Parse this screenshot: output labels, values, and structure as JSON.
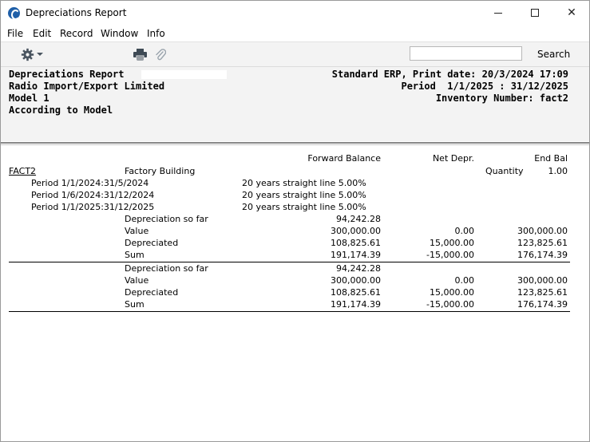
{
  "window": {
    "title": "Depreciations Report",
    "controls": {
      "minimize": "—",
      "maximize": "☐",
      "close": "✕"
    }
  },
  "menu": [
    "File",
    "Edit",
    "Record",
    "Window",
    "Info"
  ],
  "toolbar": {
    "icons": [
      "gear-icon",
      "print-icon",
      "paperclip-icon"
    ],
    "search_value": "",
    "search_label": "Search"
  },
  "header": {
    "left": [
      "Depreciations Report",
      "Radio Import/Export Limited",
      "Model 1",
      "According to Model"
    ],
    "right": [
      "Standard ERP, Print date: 20/3/2024 17:09",
      "Period  1/1/2025 : 31/12/2025",
      "Inventory Number: fact2"
    ]
  },
  "report": {
    "columns": {
      "forward_balance": "Forward Balance",
      "net_depr": "Net Depr.",
      "end_bal": "End Bal"
    },
    "asset": {
      "code": "FACT2",
      "name": "Factory Building",
      "quantity_label": "Quantity",
      "quantity": "1.00",
      "periods": [
        {
          "period": "Period 1/1/2024:31/5/2024",
          "method": "20 years straight line 5.00%"
        },
        {
          "period": "Period 1/6/2024:31/12/2024",
          "method": "20 years straight line 5.00%"
        },
        {
          "period": "Period 1/1/2025:31/12/2025",
          "method": "20 years straight line 5.00%"
        }
      ],
      "summary": [
        {
          "label": "Depreciation so far",
          "forward": "94,242.28",
          "net": "",
          "end": ""
        },
        {
          "label": "Value",
          "forward": "300,000.00",
          "net": "0.00",
          "end": "300,000.00"
        },
        {
          "label": "Depreciated",
          "forward": "108,825.61",
          "net": "15,000.00",
          "end": "123,825.61"
        },
        {
          "label": "Sum",
          "forward": "191,174.39",
          "net": "-15,000.00",
          "end": "176,174.39"
        }
      ]
    },
    "totals": [
      {
        "label": "Depreciation so far",
        "forward": "94,242.28",
        "net": "",
        "end": ""
      },
      {
        "label": "Value",
        "forward": "300,000.00",
        "net": "0.00",
        "end": "300,000.00"
      },
      {
        "label": "Depreciated",
        "forward": "108,825.61",
        "net": "15,000.00",
        "end": "123,825.61"
      },
      {
        "label": "Sum",
        "forward": "191,174.39",
        "net": "-15,000.00",
        "end": "176,174.39"
      }
    ]
  }
}
